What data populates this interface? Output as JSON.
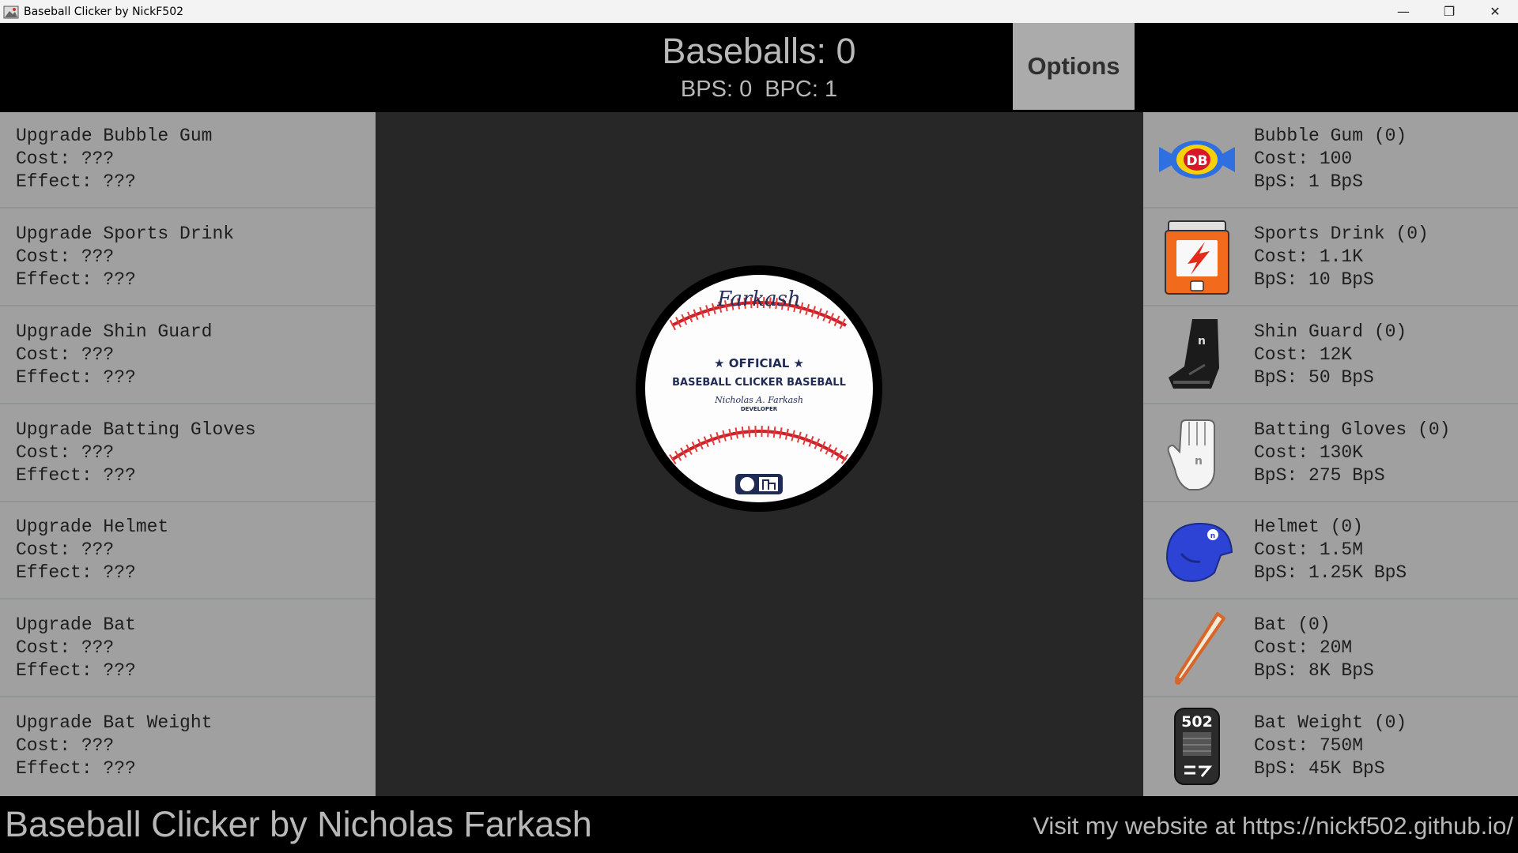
{
  "window": {
    "title": "Baseball Clicker by NickF502",
    "minimize": "—",
    "restore": "❐",
    "close": "✕"
  },
  "header": {
    "baseballs_label": "Baseballs: 0",
    "bps_label": "BPS: 0",
    "bpc_label": "BPC: 1",
    "options_label": "Options"
  },
  "upgrades": [
    {
      "name": "Upgrade Bubble Gum",
      "cost": "Cost: ???",
      "effect": "Effect: ???"
    },
    {
      "name": "Upgrade Sports Drink",
      "cost": "Cost: ???",
      "effect": "Effect: ???"
    },
    {
      "name": "Upgrade Shin Guard",
      "cost": "Cost: ???",
      "effect": "Effect: ???"
    },
    {
      "name": "Upgrade Batting Gloves",
      "cost": "Cost: ???",
      "effect": "Effect: ???"
    },
    {
      "name": "Upgrade Helmet",
      "cost": "Cost: ???",
      "effect": "Effect: ???"
    },
    {
      "name": "Upgrade Bat",
      "cost": "Cost: ???",
      "effect": "Effect: ???"
    },
    {
      "name": "Upgrade Bat Weight",
      "cost": "Cost: ???",
      "effect": "Effect: ???"
    }
  ],
  "ball": {
    "brand": "Farkash",
    "official": "★ OFFICIAL ★",
    "product": "BASEBALL CLICKER BASEBALL",
    "signature": "Nicholas A. Farkash",
    "role": "DEVELOPER"
  },
  "items": [
    {
      "icon": "bubble-gum-icon",
      "name": "Bubble Gum (0)",
      "cost": "Cost: 100",
      "bps": "BpS: 1 BpS",
      "icon_text": "DB"
    },
    {
      "icon": "sports-drink-icon",
      "name": "Sports Drink (0)",
      "cost": "Cost: 1.1K",
      "bps": "BpS: 10 BpS"
    },
    {
      "icon": "shin-guard-icon",
      "name": "Shin Guard (0)",
      "cost": "Cost: 12K",
      "bps": "BpS: 50 BpS"
    },
    {
      "icon": "batting-gloves-icon",
      "name": "Batting Gloves (0)",
      "cost": "Cost: 130K",
      "bps": "BpS: 275 BpS"
    },
    {
      "icon": "helmet-icon",
      "name": "Helmet (0)",
      "cost": "Cost: 1.5M",
      "bps": "BpS: 1.25K BpS"
    },
    {
      "icon": "bat-icon",
      "name": "Bat (0)",
      "cost": "Cost: 20M",
      "bps": "BpS: 8K BpS"
    },
    {
      "icon": "bat-weight-icon",
      "name": "Bat Weight (0)",
      "cost": "Cost: 750M",
      "bps": "BpS: 45K BpS",
      "icon_text": "502"
    }
  ],
  "footer": {
    "credit": "Baseball Clicker by Nicholas Farkash",
    "website": "Visit my website at https://nickf502.github.io/"
  },
  "colors": {
    "panel": "#a0a0a0",
    "center": "#272727",
    "header": "#000000",
    "text_light": "#b8b8b8"
  }
}
